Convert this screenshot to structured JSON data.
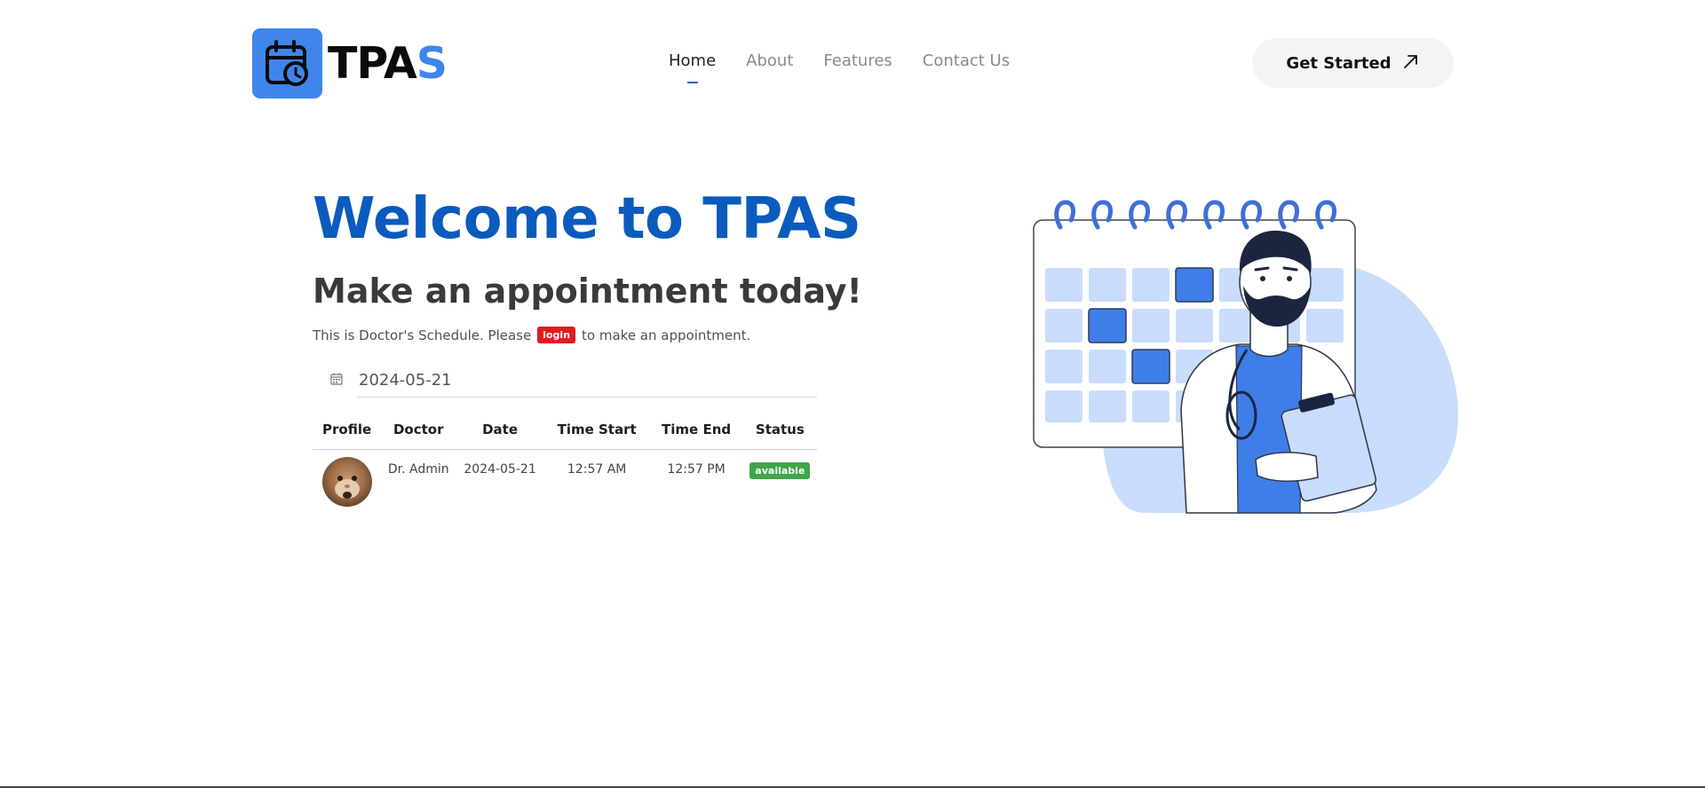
{
  "brand": {
    "name_dark": "TPA",
    "name_accent": "S",
    "logo_icon": "calendar-clock-icon",
    "accent_color": "#3f85ec"
  },
  "nav": {
    "items": [
      {
        "label": "Home",
        "active": true
      },
      {
        "label": "About",
        "active": false
      },
      {
        "label": "Features",
        "active": false
      },
      {
        "label": "Contact Us",
        "active": false
      }
    ]
  },
  "cta": {
    "label": "Get Started",
    "icon": "arrow-up-right-icon"
  },
  "hero": {
    "title": "Welcome to TPAS",
    "subtitle": "Make an appointment today!",
    "note_before": "This is Doctor's Schedule. Please",
    "login_label": "login",
    "note_after": "to make an appointment."
  },
  "date_filter": {
    "icon": "calendar-icon",
    "value": "2024-05-21"
  },
  "schedule_table": {
    "headers": [
      "Profile",
      "Doctor",
      "Date",
      "Time Start",
      "Time End",
      "Status"
    ],
    "rows": [
      {
        "profile_image": "cat-avatar",
        "doctor": "Dr. Admin",
        "date": "2024-05-21",
        "time_start": "12:57 AM",
        "time_end": "12:57 PM",
        "status": "available"
      }
    ]
  },
  "illustration": "doctor-calendar-illustration",
  "colors": {
    "title_blue": "#0a5bbd",
    "login_red": "#e01b22",
    "status_green": "#3ea54a",
    "calendar_light": "#c9dcfb",
    "calendar_highlight": "#3f7ee8"
  }
}
